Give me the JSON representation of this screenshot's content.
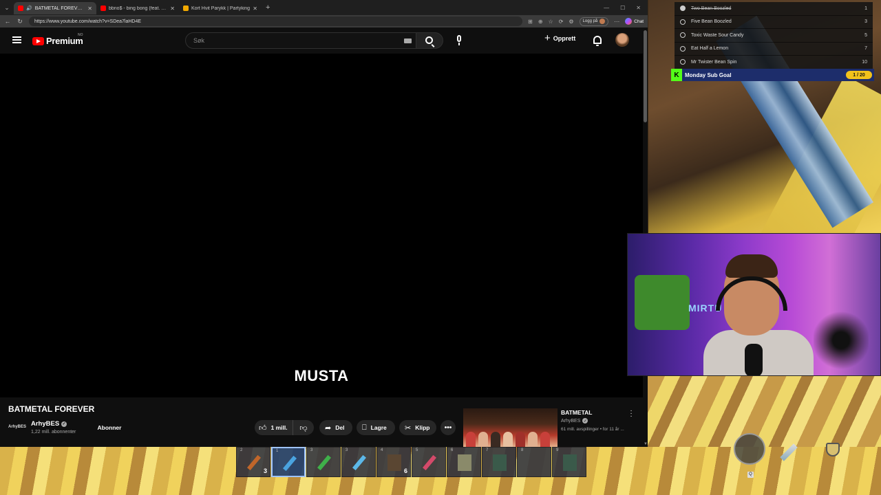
{
  "browser": {
    "tabs": [
      {
        "title": "BATMETAL FOREVER - YouTube",
        "favicon_color": "#ff0000",
        "active": true
      },
      {
        "title": "bbno$ - bing bong (feat. VNLLA)",
        "favicon_color": "#ff0000",
        "active": false
      },
      {
        "title": "Kort Hvit Parykk | Partyking",
        "favicon_color": "#f2a900",
        "active": false
      }
    ],
    "url": "https://www.youtube.com/watch?v=SDea7laHD4E",
    "login_label": "Logg på",
    "chat_label": "Chat"
  },
  "youtube": {
    "logo_text": "Premium",
    "region": "NO",
    "search_placeholder": "Søk",
    "create_label": "Opprett",
    "subtitle": "MUSTA",
    "video_title": "BATMETAL FOREVER",
    "channel": {
      "avatar_text": "ArhyBES",
      "name": "ArhyBES",
      "subscribers": "1,22 mill. abonnenter",
      "subscribe_label": "Abonner"
    },
    "actions": {
      "likes": "1 mill.",
      "share": "Del",
      "save": "Lagre",
      "clip": "Klipp"
    },
    "recommended": {
      "title": "BATMETAL",
      "channel": "ArhyBES",
      "meta": "61 mill. avspillinger • for 11 år ..."
    }
  },
  "overlay": {
    "goals": [
      {
        "label": "Two Bean Boozled",
        "count": "1",
        "done": true
      },
      {
        "label": "Five Bean Boozled",
        "count": "3",
        "done": false
      },
      {
        "label": "Toxic Waste Sour Candy",
        "count": "5",
        "done": false
      },
      {
        "label": "Eat Half a Lemon",
        "count": "7",
        "done": false
      },
      {
        "label": "Mr Twister Bean Spin",
        "count": "10",
        "done": false
      }
    ],
    "sub_goal": {
      "label": "Monday Sub Goal",
      "progress_text": "1 / 20",
      "kick_letter": "K",
      "accent": "#f2c21b"
    },
    "webcam_sign": "MIRTU"
  },
  "game": {
    "hotbar": [
      {
        "num": "2",
        "count": "3",
        "item": "torch",
        "color": "#c0662a"
      },
      {
        "num": "1",
        "count": "",
        "item": "diamond-sword",
        "color": "#4aa3e0",
        "selected": true
      },
      {
        "num": "3",
        "count": "",
        "item": "emerald-pickaxe",
        "color": "#3fb04a"
      },
      {
        "num": "3",
        "count": "",
        "item": "diamond-pickaxe",
        "color": "#5cb8e8"
      },
      {
        "num": "4",
        "count": "6",
        "item": "block",
        "color": "#5a4632"
      },
      {
        "num": "5",
        "count": "",
        "item": "rocket",
        "color": "#d44a6a"
      },
      {
        "num": "6",
        "count": "",
        "item": "statue",
        "color": "#8a8a6a"
      },
      {
        "num": "7",
        "count": "",
        "item": "moss-block",
        "color": "#3a5a4a"
      },
      {
        "num": "8",
        "count": "",
        "item": "empty",
        "color": ""
      },
      {
        "num": "9",
        "count": "",
        "item": "moss-block",
        "color": "#3a5a4a"
      }
    ],
    "hud_keys": [
      "Q",
      "",
      ""
    ]
  }
}
